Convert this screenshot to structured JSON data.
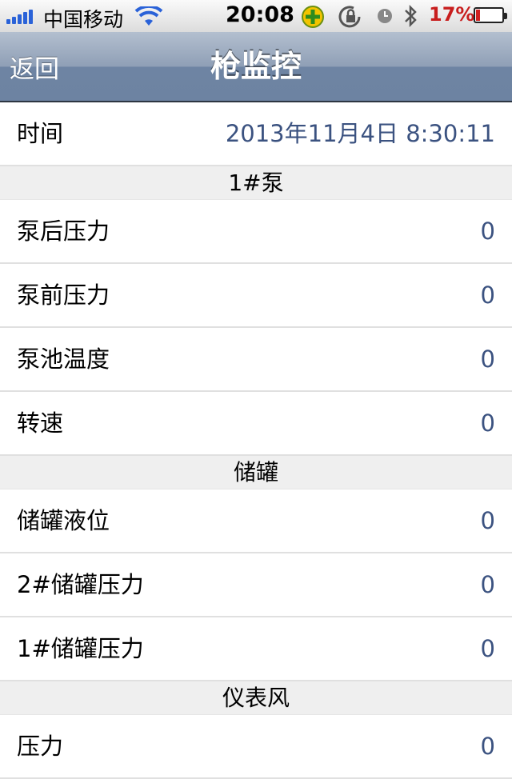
{
  "status_bar": {
    "carrier": "中国移动",
    "time": "20:08",
    "battery_percent": "17%",
    "battery_level": 0.17,
    "icons": [
      "signal-icon",
      "wifi-icon",
      "app-badge-icon",
      "rotation-lock-icon",
      "alarm-icon",
      "bluetooth-icon",
      "battery-icon"
    ]
  },
  "nav": {
    "back_label": "返回",
    "title": "枪监控"
  },
  "time_row": {
    "label": "时间",
    "value": "2013年11月4日 8:30:11"
  },
  "sections": [
    {
      "header": "1#泵",
      "rows": [
        {
          "label": "泵后压力",
          "value": "0"
        },
        {
          "label": "泵前压力",
          "value": "0"
        },
        {
          "label": "泵池温度",
          "value": "0"
        },
        {
          "label": "转速",
          "value": "0"
        }
      ]
    },
    {
      "header": "储罐",
      "rows": [
        {
          "label": "储罐液位",
          "value": "0"
        },
        {
          "label": "2#储罐压力",
          "value": "0"
        },
        {
          "label": "1#储罐压力",
          "value": "0"
        }
      ]
    },
    {
      "header": "仪表风",
      "rows": [
        {
          "label": "压力",
          "value": "0"
        }
      ]
    }
  ],
  "colors": {
    "accent_value": "#3b5280",
    "nav_bar": "#6e84a3",
    "battery_low": "#c81e1e",
    "signal": "#2a62d8"
  }
}
